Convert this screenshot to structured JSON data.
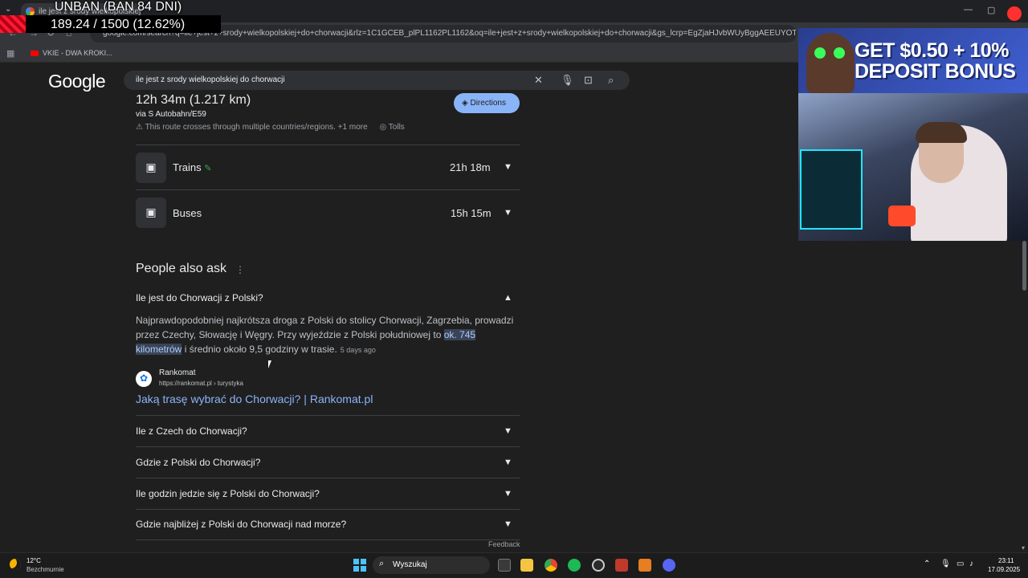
{
  "browser": {
    "tab_title": "ile jest z srody wielkopolskiej do chorwacji",
    "url": "google.com/search?q=ile+jest+z+srody+wielkopolskiej+do+chorwacji&rlz=1C1GCEB_plPL1162PL1162&oq=ile+jest+z+srody+wielkopolskiej+do+chorwacji&gs_lcrp=EgZjaHJvbWUyBggAEEUYOTIJCAEQIRgKGKA",
    "bookmark": "VKIE - DWA KROKI..."
  },
  "overlay": {
    "ban_text": "UNBAN (BAN 84 DNI)",
    "counter_text": "189.24 / 1500 (12.62%)"
  },
  "google": {
    "logo": "Google",
    "query": "ile jest z srody wielkopolskiej do chorwacji"
  },
  "route": {
    "time": "12h 34m (1.217 km)",
    "via": "via S Autobahn/E59",
    "note": "This route crosses through multiple countries/regions. +1 more",
    "tolls": "Tolls",
    "directions": "Directions"
  },
  "modes": [
    {
      "label": "Trains",
      "time": "21h 18m"
    },
    {
      "label": "Buses",
      "time": "15h 15m"
    }
  ],
  "paa": {
    "title": "People also ask",
    "expanded_question": "Ile jest do Chorwacji z Polski?",
    "answer_before": "Najprawdopodobniej najkrótsza droga z Polski do stolicy Chorwacji, Zagrzebia, prowadzi przez Czechy, Słowację i Węgry. Przy wyjeździe z Polski południowej to ",
    "answer_highlight": "ok. 745 kilometrów",
    "answer_after": " i średnio około 9,5 godziny w trasie.",
    "answer_age": "5 days ago",
    "source_name": "Rankomat",
    "source_url": "https://rankomat.pl › turystyka",
    "source_link": "Jaką trasę wybrać do Chorwacji? | Rankomat.pl",
    "questions": [
      "Ile z Czech do Chorwacji?",
      "Gdzie z Polski do Chorwacji?",
      "Ile godzin jedzie się z Polski do Chorwacji?",
      "Gdzie najbliżej z Polski do Chorwacji nad morze?"
    ],
    "feedback": "Feedback"
  },
  "promo": {
    "line1": "GET $0.50 + 10%",
    "line2": "DEPOSIT BONUS"
  },
  "taskbar": {
    "temperature": "12°C",
    "weather": "Bezchmurnie",
    "search_placeholder": "Wyszukaj",
    "time": "23:11",
    "date": "17.09.2025"
  }
}
